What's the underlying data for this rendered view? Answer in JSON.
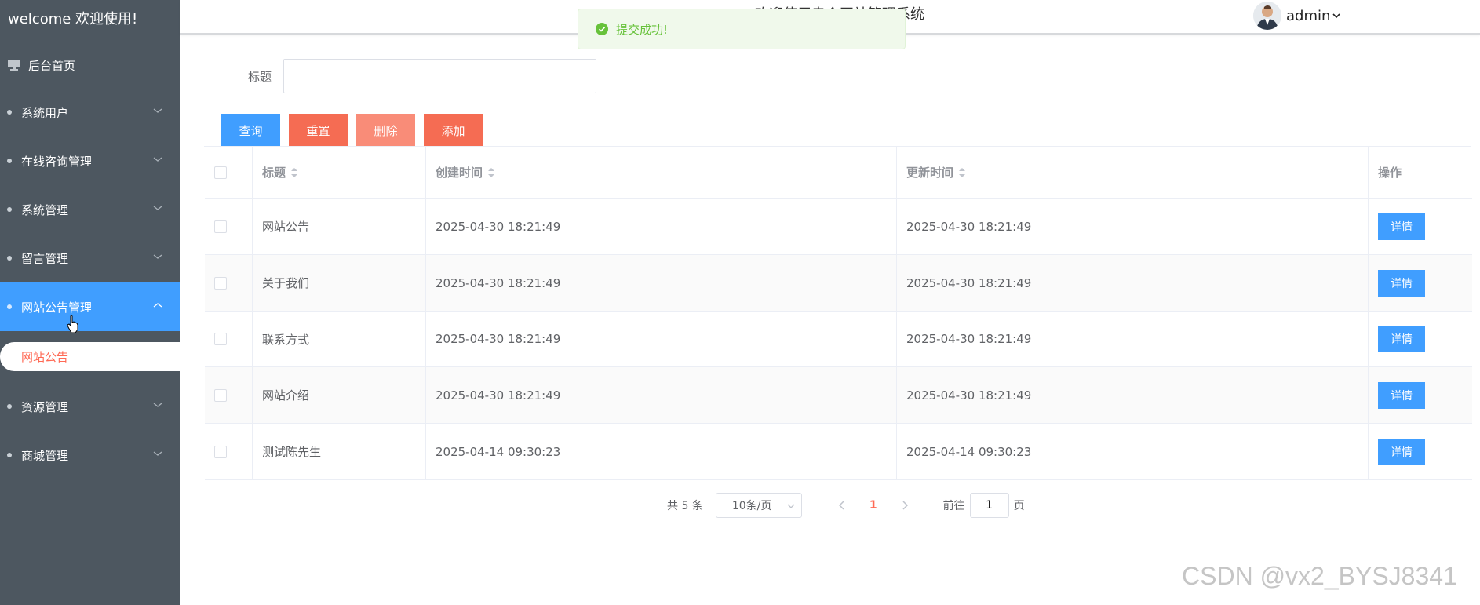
{
  "sidebar": {
    "welcome": "welcome 欢迎使用!",
    "home": "后台首页",
    "items": [
      {
        "label": "系统用户"
      },
      {
        "label": "在线咨询管理"
      },
      {
        "label": "系统管理"
      },
      {
        "label": "留言管理"
      },
      {
        "label": "网站公告管理"
      },
      {
        "label": "资源管理"
      },
      {
        "label": "商城管理"
      }
    ],
    "active_sub": "网站公告"
  },
  "header": {
    "title": "欢迎使用幸会网站管理系统",
    "username": "admin"
  },
  "toast": {
    "message": "提交成功!"
  },
  "search": {
    "label": "标题",
    "value": "",
    "placeholder": ""
  },
  "buttons": {
    "query": "查询",
    "reset": "重置",
    "delete": "删除",
    "add": "添加"
  },
  "table": {
    "columns": [
      "标题",
      "创建时间",
      "更新时间",
      "操作"
    ],
    "rows": [
      {
        "title": "网站公告",
        "created": "2025-04-30 18:21:49",
        "updated": "2025-04-30 18:21:49",
        "action": "详情"
      },
      {
        "title": "关于我们",
        "created": "2025-04-30 18:21:49",
        "updated": "2025-04-30 18:21:49",
        "action": "详情"
      },
      {
        "title": "联系方式",
        "created": "2025-04-30 18:21:49",
        "updated": "2025-04-30 18:21:49",
        "action": "详情"
      },
      {
        "title": "网站介绍",
        "created": "2025-04-30 18:21:49",
        "updated": "2025-04-30 18:21:49",
        "action": "详情"
      },
      {
        "title": "测试陈先生",
        "created": "2025-04-14 09:30:23",
        "updated": "2025-04-14 09:30:23",
        "action": "详情"
      }
    ]
  },
  "pagination": {
    "total": "共 5 条",
    "page_size": "10条/页",
    "current": "1",
    "goto_label": "前往",
    "goto_value": "1",
    "unit": "页"
  },
  "watermark": "CSDN @vx2_BYSJ8341",
  "colors": {
    "primary": "#409eff",
    "danger": "#f56c53",
    "sidebar": "#4d5760",
    "success": "#67c23a"
  }
}
